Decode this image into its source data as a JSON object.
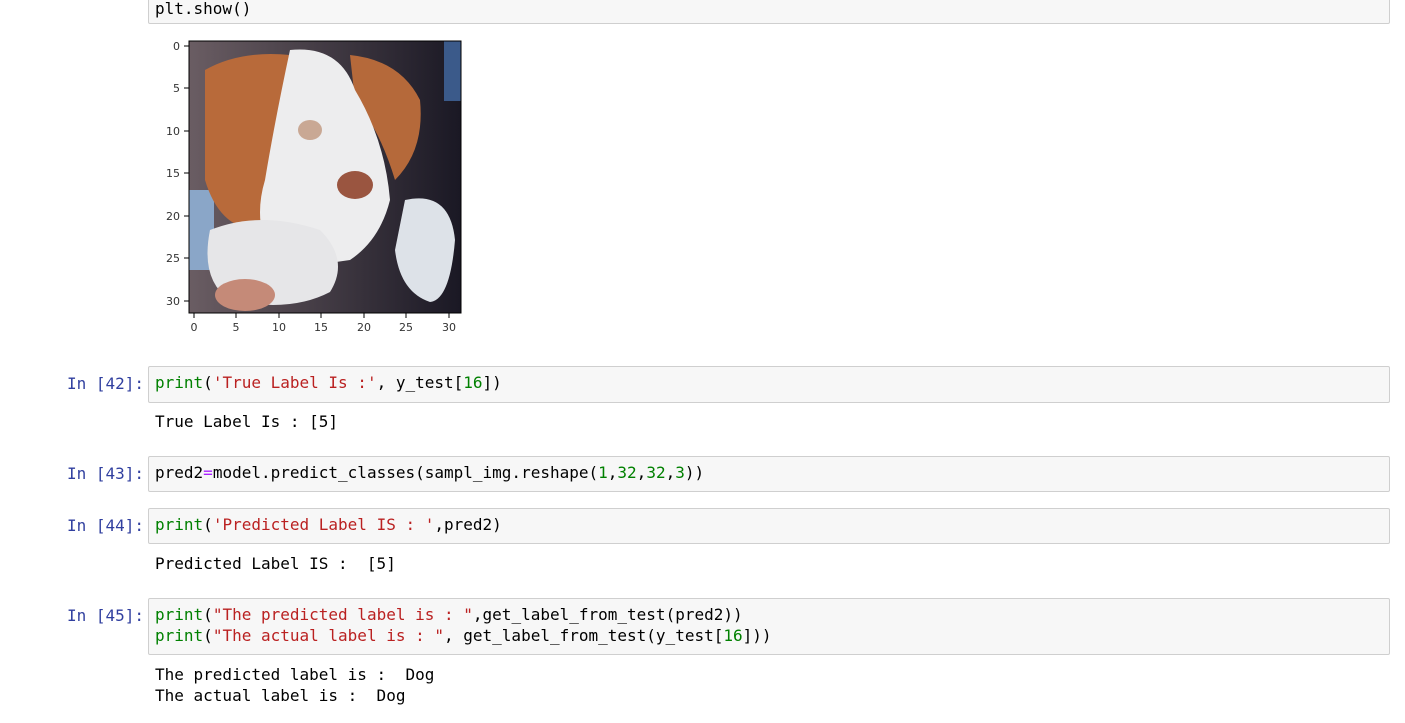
{
  "top_cell": {
    "code": "plt.show()"
  },
  "plot": {
    "y_ticks": [
      "0",
      "5",
      "10",
      "15",
      "20",
      "25",
      "30"
    ],
    "x_ticks": [
      "0",
      "5",
      "10",
      "15",
      "20",
      "25",
      "30"
    ]
  },
  "cells": [
    {
      "prompt": "In [42]:",
      "code_parts": [
        "print",
        "(",
        "'True Label Is :'",
        ", y_test[",
        "16",
        "])"
      ],
      "output": "True Label Is : [5]"
    },
    {
      "prompt": "In [43]:",
      "code_parts": [
        "pred2",
        "=",
        "model.predict_classes(sampl_img.reshape(",
        "1",
        ",",
        "32",
        ",",
        "32",
        ",",
        "3",
        "))"
      ]
    },
    {
      "prompt": "In [44]:",
      "code_parts": [
        "print",
        "(",
        "'Predicted Label IS : '",
        ",pred2)"
      ],
      "output": "Predicted Label IS :  [5]"
    },
    {
      "prompt": "In [45]:",
      "line1_parts": [
        "print",
        "(",
        "\"The predicted label is : \"",
        ",get_label_from_test(pred2))"
      ],
      "line2_parts": [
        "print",
        "(",
        "\"The actual label is : \"",
        ", get_label_from_test(y_test[",
        "16",
        "]))"
      ],
      "output_lines": [
        "The predicted label is :  Dog",
        "The actual label is :  Dog"
      ]
    }
  ]
}
